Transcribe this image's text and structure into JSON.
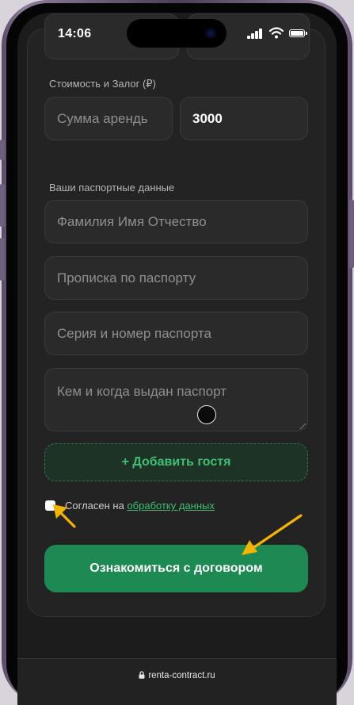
{
  "status": {
    "time": "14:06"
  },
  "form": {
    "cost_label": "Стоимость и Залог (₽)",
    "rent_placeholder": "Сумма арендь",
    "deposit_value": "3000",
    "passport_label": "Ваши паспортные данные",
    "fullname_placeholder": "Фамилия Имя Отчество",
    "registration_placeholder": "Прописка по паспорту",
    "passport_number_placeholder": "Серия и номер паспорта",
    "issued_placeholder": "Кем и когда выдан паспорт",
    "add_guest_label": "+ Добавить гостя",
    "agree_prefix": "Согласен на ",
    "agree_link": "обработку данных",
    "agree_checked": false,
    "submit_label": "Ознакомиться с договором"
  },
  "browser": {
    "url": "renta-contract.ru"
  },
  "colors": {
    "accent": "#1c8a52",
    "accent_text": "#3fbf74",
    "annotation_arrow": "#f5b400"
  }
}
